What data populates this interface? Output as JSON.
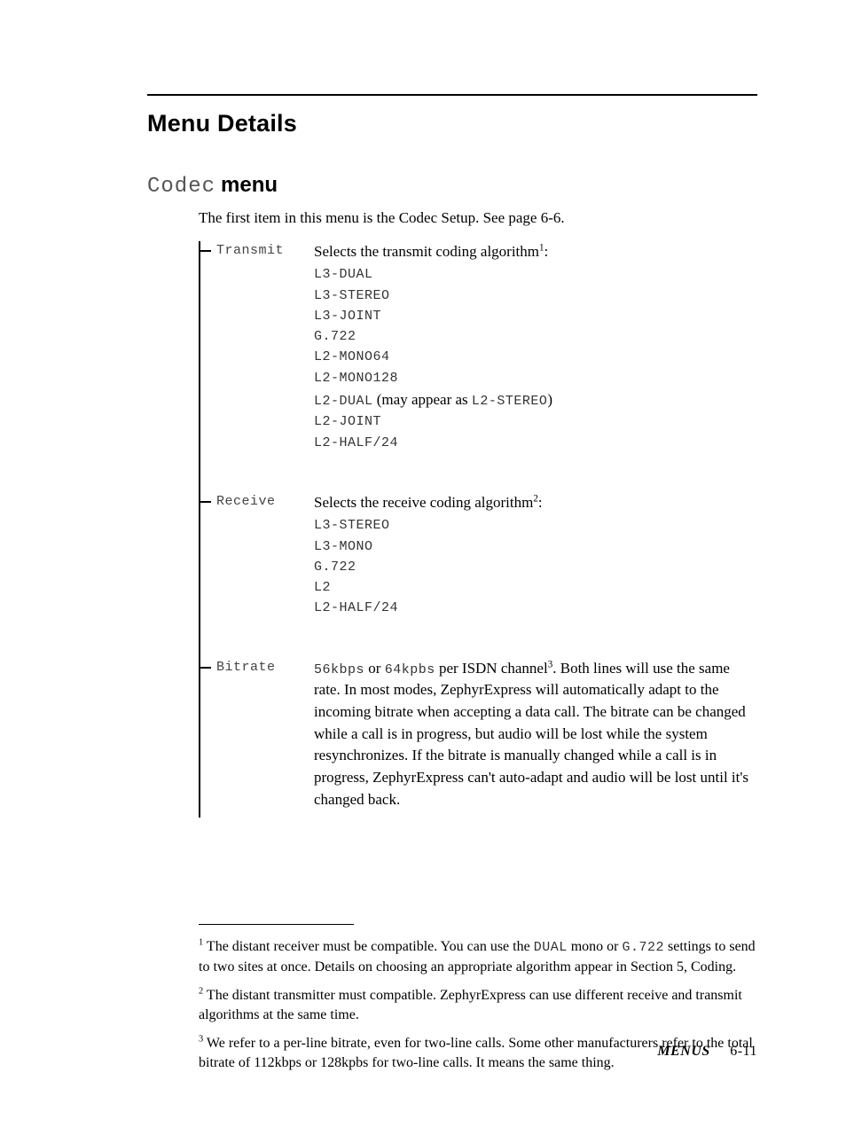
{
  "heading_main": "Menu Details",
  "heading_sub_lcd": "Codec",
  "heading_sub_bold": "menu",
  "intro": "The first item in this menu is the Codec Setup. See page 6-6.",
  "entries": [
    {
      "label": "Transmit",
      "lead_prefix": "Selects the transmit coding algorithm",
      "lead_supnum": "1",
      "lead_suffix": ":",
      "options": [
        {
          "code": "L3-DUAL"
        },
        {
          "code": "L3-STEREO"
        },
        {
          "code": "L3-JOINT"
        },
        {
          "code": "G.722"
        },
        {
          "code": "L2-MONO64"
        },
        {
          "code": "L2-MONO128"
        },
        {
          "code": "L2-DUAL",
          "note_prefix": "  (may appear as ",
          "note_code": "L2-STEREO",
          "note_suffix": ")"
        },
        {
          "code": "L2-JOINT"
        },
        {
          "code": "L2-HALF/24"
        }
      ]
    },
    {
      "label": "Receive",
      "lead_prefix": "Selects the receive coding algorithm",
      "lead_supnum": "2",
      "lead_suffix": ":",
      "options": [
        {
          "code": "L3-STEREO"
        },
        {
          "code": "L3-MONO"
        },
        {
          "code": "G.722"
        },
        {
          "code": "L2"
        },
        {
          "code": "L2-HALF/24"
        }
      ]
    },
    {
      "label": "Bitrate",
      "body_segments": [
        {
          "type": "mono",
          "text": "56kbps"
        },
        {
          "type": "text",
          "text": " or "
        },
        {
          "type": "mono",
          "text": "64kpbs"
        },
        {
          "type": "text",
          "text": " per ISDN channel"
        },
        {
          "type": "sup",
          "text": "3"
        },
        {
          "type": "text",
          "text": ". Both lines will use the same rate. In most modes, ZephyrExpress will automatically adapt to the incoming bitrate when accepting a data call. The bitrate can be changed while a call is in progress, but audio will be lost while the system resynchronizes. If the bitrate is manually changed while a call is in progress, ZephyrExpress can't auto-adapt and audio will be lost until it's changed back."
        }
      ]
    }
  ],
  "footnotes": [
    {
      "num": "1",
      "segments": [
        {
          "type": "text",
          "text": " The distant receiver must be compatible. You can use the "
        },
        {
          "type": "mono",
          "text": "DUAL"
        },
        {
          "type": "text",
          "text": " mono or "
        },
        {
          "type": "mono",
          "text": "G.722"
        },
        {
          "type": "text",
          "text": " settings to send to two sites at once. Details on choosing an appropriate algorithm appear in Section 5, Coding."
        }
      ]
    },
    {
      "num": "2",
      "segments": [
        {
          "type": "text",
          "text": " The distant transmitter must compatible. ZephyrExpress can use different receive and transmit algorithms at the same time."
        }
      ]
    },
    {
      "num": "3",
      "segments": [
        {
          "type": "text",
          "text": " We refer to a per-line bitrate, even for two-line calls. Some other manufacturers refer to the total bitrate of 112kbps or 128kpbs for two-line calls. It means the same thing."
        }
      ]
    }
  ],
  "footer_section": "MENUS",
  "footer_page": "6-11"
}
